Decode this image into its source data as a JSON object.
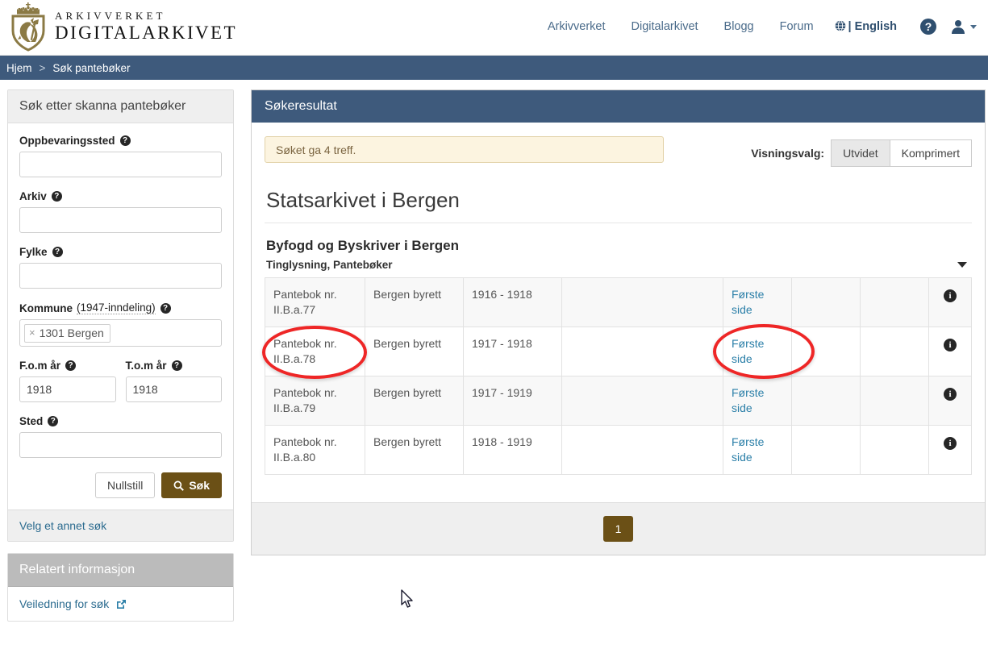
{
  "header": {
    "logo_line1": "ARKIVVERKET",
    "logo_line2": "DIGITALARKIVET",
    "logo_icon": "norwegian-coat-of-arms",
    "nav": [
      {
        "label": "Arkivverket"
      },
      {
        "label": "Digitalarkivet"
      },
      {
        "label": "Blogg"
      },
      {
        "label": "Forum"
      }
    ],
    "language": {
      "icon": "globe-icon",
      "separator": "|",
      "label": "English"
    },
    "help_icon": "question-circle-icon",
    "user_icon": "user-icon"
  },
  "breadcrumb": {
    "home": "Hjem",
    "separator": ">",
    "current": "Søk pantebøker"
  },
  "sidebar": {
    "search_panel": {
      "title": "Søk etter skanna pantebøker",
      "fields": [
        {
          "label": "Oppbevaringssted",
          "value": "",
          "help": "?"
        },
        {
          "label": "Arkiv",
          "value": "",
          "help": "?"
        },
        {
          "label": "Fylke",
          "value": "",
          "help": "?"
        }
      ],
      "kommune": {
        "label": "Kommune",
        "sublabel": "(1947-inndeling)",
        "help": "?",
        "tag_remove": "×",
        "tag_value": "1301 Bergen"
      },
      "year_from": {
        "label": "F.o.m år",
        "help": "?",
        "value": "1918"
      },
      "year_to": {
        "label": "T.o.m år",
        "help": "?",
        "value": "1918"
      },
      "sted": {
        "label": "Sted",
        "help": "?",
        "value": ""
      },
      "reset_label": "Nullstill",
      "search_label": "Søk",
      "search_icon": "search-icon",
      "other_search_link": "Velg et annet søk"
    },
    "related_panel": {
      "title": "Relatert informasjon",
      "link_label": "Veiledning for søk",
      "link_icon": "external-link-icon"
    }
  },
  "results": {
    "panel_title": "Søkeresultat",
    "alert": "Søket ga 4 treff.",
    "view_label": "Visningsvalg:",
    "view_options": [
      {
        "label": "Utvidet",
        "active": true
      },
      {
        "label": "Komprimert",
        "active": false
      }
    ],
    "archive_title": "Statsarkivet i Bergen",
    "group_title": "Byfogd og Byskriver i Bergen",
    "group_subtitle": "Tinglysning, Pantebøker",
    "collapse_icon": "chevron-down-icon",
    "rows": [
      {
        "name": "Pantebok nr. II.B.a.77",
        "court": "Bergen byrett",
        "years": "1916 - 1918",
        "extra": "",
        "link": "Første side",
        "col6": "",
        "col7": "",
        "info_icon": "info-icon"
      },
      {
        "name": "Pantebok nr. II.B.a.78",
        "court": "Bergen byrett",
        "years": "1917 - 1918",
        "extra": "",
        "link": "Første side",
        "col6": "",
        "col7": "",
        "info_icon": "info-icon"
      },
      {
        "name": "Pantebok nr. II.B.a.79",
        "court": "Bergen byrett",
        "years": "1917 - 1919",
        "extra": "",
        "link": "Første side",
        "col6": "",
        "col7": "",
        "info_icon": "info-icon"
      },
      {
        "name": "Pantebok nr. II.B.a.80",
        "court": "Bergen byrett",
        "years": "1918 - 1919",
        "extra": "",
        "link": "Første side",
        "col6": "",
        "col7": "",
        "info_icon": "info-icon"
      }
    ],
    "pagination": {
      "current_page": "1"
    }
  },
  "annotations": [
    {
      "name": "highlight-pantebok-78",
      "shape": "ellipse",
      "color": "#ee2626"
    },
    {
      "name": "highlight-forste-side-row2",
      "shape": "ellipse",
      "color": "#ee2626"
    }
  ],
  "colors": {
    "header_blue": "#3e5a7c",
    "brand_gold": "#6b5016",
    "link_blue": "#2b7fa8",
    "alert_bg": "#fcf4e0",
    "annotation_red": "#ee2626"
  }
}
